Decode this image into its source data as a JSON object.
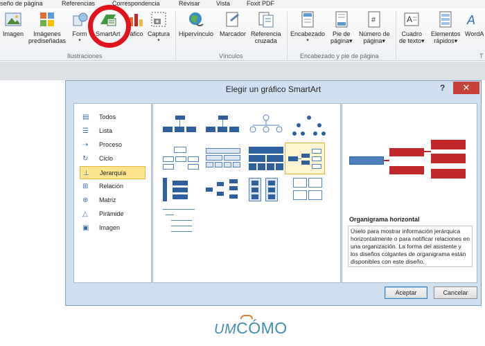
{
  "ribbon_tabs": [
    "seño de página",
    "Referencias",
    "Correspondencia",
    "Revisar",
    "Vista",
    "Foxit PDF"
  ],
  "ribbon": {
    "buttons": [
      {
        "label": "Imagen",
        "line2": ""
      },
      {
        "label": "Imágenes",
        "line2": "prediseñadas"
      },
      {
        "label": "Form",
        "line2": ""
      },
      {
        "label": "SmartArt",
        "line2": ""
      },
      {
        "label": "áfico",
        "line2": ""
      },
      {
        "label": "Captura",
        "line2": ""
      },
      {
        "label": "Hipervínculo",
        "line2": ""
      },
      {
        "label": "Marcador",
        "line2": ""
      },
      {
        "label": "Referencia",
        "line2": "cruzada"
      },
      {
        "label": "Encabezado",
        "line2": ""
      },
      {
        "label": "Pie de",
        "line2": "página"
      },
      {
        "label": "Número de",
        "line2": "página"
      },
      {
        "label": "Cuadro",
        "line2": "de texto"
      },
      {
        "label": "Elementos",
        "line2": "rápidos"
      },
      {
        "label": "WordA",
        "line2": ""
      }
    ],
    "groups": [
      "Ilustraciones",
      "Vínculos",
      "Encabezado y pie de página",
      "T"
    ]
  },
  "dialog": {
    "title": "Elegir un gráfico SmartArt",
    "help": "?",
    "close": "✕",
    "categories": [
      {
        "label": "Todos",
        "icon": "all-icon"
      },
      {
        "label": "Lista",
        "icon": "list-icon"
      },
      {
        "label": "Proceso",
        "icon": "process-icon"
      },
      {
        "label": "Ciclo",
        "icon": "cycle-icon"
      },
      {
        "label": "Jerarquía",
        "icon": "hierarchy-icon"
      },
      {
        "label": "Relación",
        "icon": "relation-icon"
      },
      {
        "label": "Matriz",
        "icon": "matrix-icon"
      },
      {
        "label": "Pirámide",
        "icon": "pyramid-icon"
      },
      {
        "label": "Imagen",
        "icon": "image-icon"
      }
    ],
    "selected_category": "Jerarquía",
    "preview": {
      "title": "Organigrama horizontal",
      "description": "Úselo para mostrar información jerárquica horizontalmente o para notificar relaciones en una organización. La forma del asistente y los diseños colgantes de organigrama están disponibles con este diseño."
    },
    "ok_label": "Aceptar",
    "cancel_label": "Cancelar"
  },
  "brand": {
    "part1": "UM",
    "part2": "CÓMO"
  },
  "colors": {
    "accent_red": "#e1141b",
    "smartart_red": "#c0282c",
    "smartart_blue": "#2e5f9e",
    "selection": "#fde58f",
    "brand": "#3d8fb0"
  }
}
